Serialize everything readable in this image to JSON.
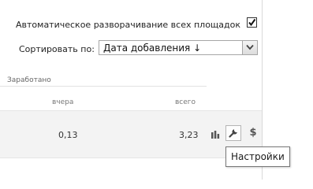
{
  "settings": {
    "auto_expand_label": "Автоматическое разворачивание всех площадок",
    "auto_expand_checked": true,
    "sort_label": "Сортировать по:",
    "sort_value": "Дата добавления ↓"
  },
  "table": {
    "group_header": "Заработано",
    "columns": {
      "yesterday": "вчера",
      "total": "всего"
    },
    "row": {
      "yesterday": "0,13",
      "total": "3,23"
    }
  },
  "actions": {
    "money_symbol": "$"
  },
  "tooltip": {
    "text": "Настройки"
  },
  "icons": [
    "bar-chart-icon",
    "wrench-icon",
    "dollar-icon",
    "chevron-down-icon",
    "checkmark-icon"
  ],
  "colors": {
    "row_background": "#f3f3f3",
    "divider": "#e2e2e2",
    "icon": "#555555"
  }
}
